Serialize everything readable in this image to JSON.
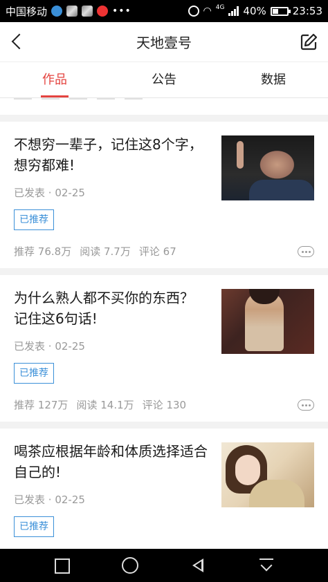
{
  "status_bar": {
    "carrier": "中国移动",
    "network": "4G",
    "battery": "40%",
    "battery_level": 0.4,
    "time": "23:53"
  },
  "header": {
    "title": "天地壹号"
  },
  "tabs": [
    {
      "label": "作品",
      "active": true
    },
    {
      "label": "公告",
      "active": false
    },
    {
      "label": "数据",
      "active": false
    }
  ],
  "articles": [
    {
      "title": "不想穷一辈子，记住这8个字，想穷都难!",
      "status": "已发表",
      "date": "02-25",
      "badge": "已推荐",
      "recommend_label": "推荐",
      "recommend": "76.8万",
      "read_label": "阅读",
      "read": "7.7万",
      "comment_label": "评论",
      "comment": "67"
    },
    {
      "title": "为什么熟人都不买你的东西？ 记住这6句话!",
      "status": "已发表",
      "date": "02-25",
      "badge": "已推荐",
      "recommend_label": "推荐",
      "recommend": "127万",
      "read_label": "阅读",
      "read": "14.1万",
      "comment_label": "评论",
      "comment": "130"
    },
    {
      "title": "喝茶应根据年龄和体质选择适合自己的!",
      "status": "已发表",
      "date": "02-25",
      "badge": "已推荐"
    }
  ],
  "colors": {
    "accent": "#e4433f",
    "badge": "#3a8fd8"
  }
}
